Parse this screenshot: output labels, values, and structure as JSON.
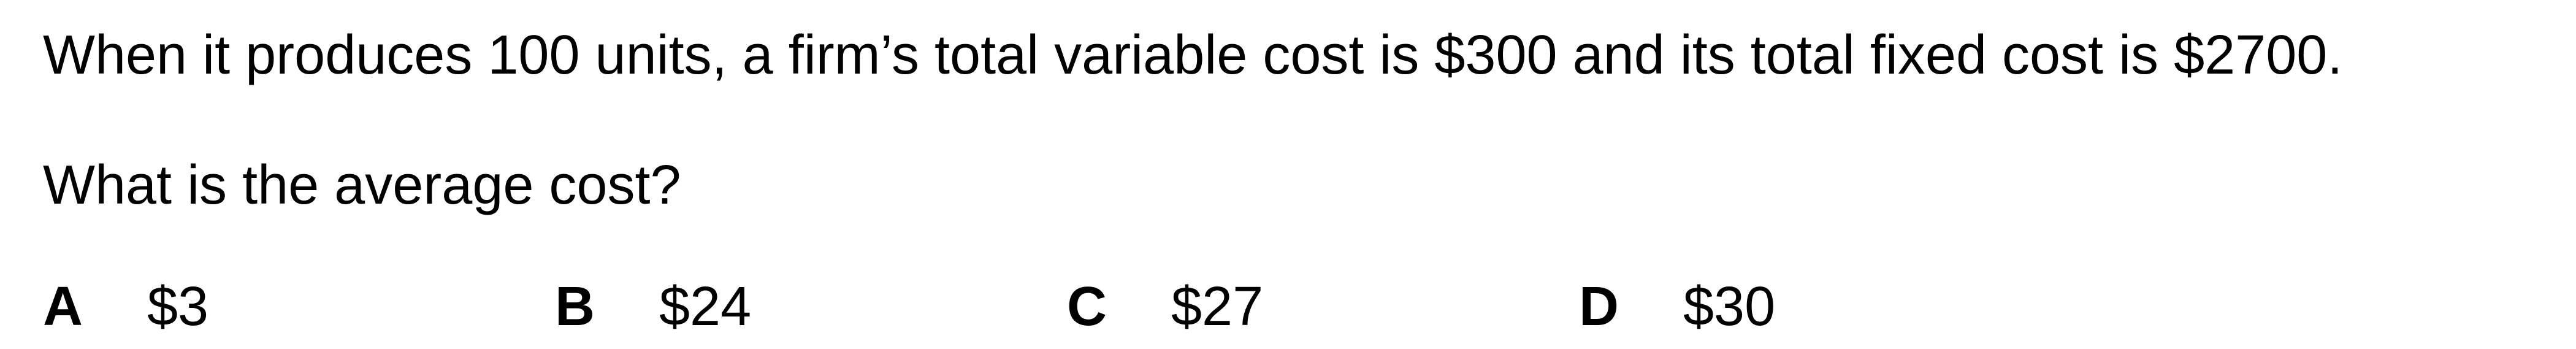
{
  "question": {
    "stem": "When it produces 100 units, a firm’s total variable cost is $300 and its total fixed cost is $2700.",
    "prompt": "What is the average cost?"
  },
  "options": [
    {
      "letter": "A",
      "text": "$3"
    },
    {
      "letter": "B",
      "text": "$24"
    },
    {
      "letter": "C",
      "text": "$27"
    },
    {
      "letter": "D",
      "text": "$30"
    }
  ]
}
